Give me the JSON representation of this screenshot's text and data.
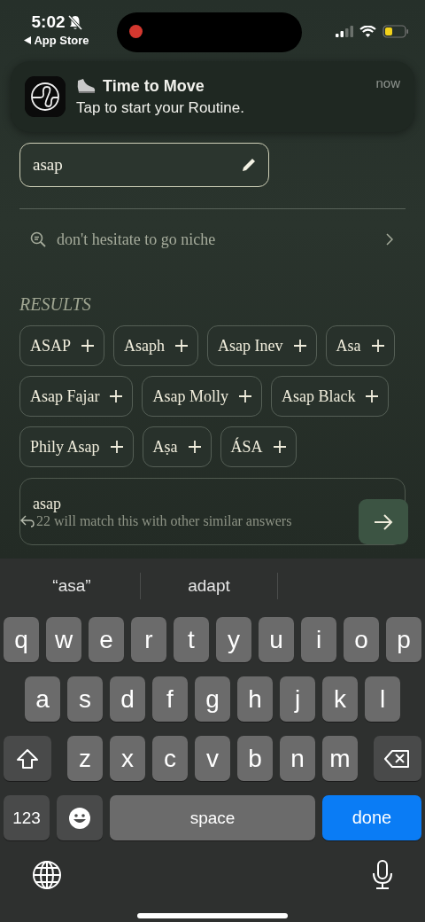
{
  "status_bar": {
    "time": "5:02",
    "back_label": "App Store"
  },
  "notification": {
    "title": "Time to Move",
    "body": "Tap to start your Routine.",
    "time": "now"
  },
  "answer_field": {
    "value": "asap"
  },
  "hint": {
    "text": "don't hesitate to go niche"
  },
  "results": {
    "heading": "RESULTS",
    "chips": [
      {
        "label": "ASAP"
      },
      {
        "label": "Asaph"
      },
      {
        "label": "Asap Inev"
      },
      {
        "label": "Asa"
      },
      {
        "label": "Asap Fajar"
      },
      {
        "label": "Asap Molly"
      },
      {
        "label": "Asap Black"
      },
      {
        "label": "Phily Asap"
      },
      {
        "label": "Aṣa"
      },
      {
        "label": "ÁSA"
      }
    ]
  },
  "custom_answer": {
    "value": "asap",
    "note": "22 will match this with other similar answers"
  },
  "keyboard": {
    "suggestions": [
      "“asa”",
      "adapt"
    ],
    "rows": [
      {
        "keys": [
          {
            "kind": "letter",
            "label": "q"
          },
          {
            "kind": "letter",
            "label": "w"
          },
          {
            "kind": "letter",
            "label": "e"
          },
          {
            "kind": "letter",
            "label": "r"
          },
          {
            "kind": "letter",
            "label": "t"
          },
          {
            "kind": "letter",
            "label": "y"
          },
          {
            "kind": "letter",
            "label": "u"
          },
          {
            "kind": "letter",
            "label": "i"
          },
          {
            "kind": "letter",
            "label": "o"
          },
          {
            "kind": "letter",
            "label": "p"
          }
        ]
      },
      {
        "keys": [
          {
            "kind": "letter",
            "label": "a"
          },
          {
            "kind": "letter",
            "label": "s"
          },
          {
            "kind": "letter",
            "label": "d"
          },
          {
            "kind": "letter",
            "label": "f"
          },
          {
            "kind": "letter",
            "label": "g"
          },
          {
            "kind": "letter",
            "label": "h"
          },
          {
            "kind": "letter",
            "label": "j"
          },
          {
            "kind": "letter",
            "label": "k"
          },
          {
            "kind": "letter",
            "label": "l"
          }
        ]
      },
      {
        "keys": [
          {
            "kind": "shift"
          },
          {
            "kind": "letter",
            "label": "z"
          },
          {
            "kind": "letter",
            "label": "x"
          },
          {
            "kind": "letter",
            "label": "c"
          },
          {
            "kind": "letter",
            "label": "v"
          },
          {
            "kind": "letter",
            "label": "b"
          },
          {
            "kind": "letter",
            "label": "n"
          },
          {
            "kind": "letter",
            "label": "m"
          },
          {
            "kind": "delete"
          }
        ]
      },
      {
        "keys": [
          {
            "kind": "numbers",
            "label": "123"
          },
          {
            "kind": "emoji"
          },
          {
            "kind": "space",
            "label": "space"
          },
          {
            "kind": "done",
            "label": "done"
          }
        ]
      }
    ]
  }
}
